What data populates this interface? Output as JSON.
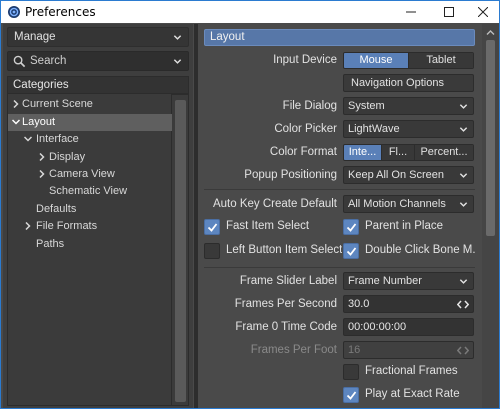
{
  "window": {
    "title": "Preferences"
  },
  "sidebar": {
    "manage_label": "Manage",
    "search_placeholder": "Search",
    "categories_label": "Categories",
    "items": [
      {
        "label": "Current Scene",
        "expandable": true,
        "expanded": false,
        "level": 0
      },
      {
        "label": "Layout",
        "expandable": true,
        "expanded": true,
        "level": 0,
        "selected": true
      },
      {
        "label": "Interface",
        "expandable": true,
        "expanded": true,
        "level": 1
      },
      {
        "label": "Display",
        "expandable": true,
        "expanded": false,
        "level": 2
      },
      {
        "label": "Camera View",
        "expandable": true,
        "expanded": false,
        "level": 2
      },
      {
        "label": "Schematic View",
        "expandable": false,
        "level": 2
      },
      {
        "label": "Defaults",
        "expandable": false,
        "level": 1
      },
      {
        "label": "File Formats",
        "expandable": true,
        "expanded": false,
        "level": 0
      },
      {
        "label": "Paths",
        "expandable": false,
        "level": 0
      }
    ]
  },
  "main": {
    "section_title": "Layout",
    "input_device": {
      "label": "Input Device",
      "options": [
        "Mouse",
        "Tablet"
      ],
      "selected": "Mouse"
    },
    "navigation_options_label": "Navigation Options",
    "file_dialog": {
      "label": "File Dialog",
      "value": "System"
    },
    "color_picker": {
      "label": "Color Picker",
      "value": "LightWave"
    },
    "color_format": {
      "label": "Color Format",
      "options": [
        "Inte...",
        "Fl...",
        "Percent..."
      ],
      "selected": "Inte..."
    },
    "popup_positioning": {
      "label": "Popup Positioning",
      "value": "Keep All On Screen"
    },
    "auto_key_create_default": {
      "label": "Auto Key Create Default",
      "value": "All Motion Channels"
    },
    "checkboxes": {
      "fast_item_select": {
        "label": "Fast Item Select",
        "checked": true
      },
      "parent_in_place": {
        "label": "Parent in Place",
        "checked": true
      },
      "left_button_item_select": {
        "label": "Left Button Item Select",
        "checked": false
      },
      "double_click_bone_mode": {
        "label": "Double Click Bone M...",
        "checked": true
      }
    },
    "frame_slider_label": {
      "label": "Frame Slider Label",
      "value": "Frame Number"
    },
    "frames_per_second": {
      "label": "Frames Per Second",
      "value": "30.0"
    },
    "frame_0_time_code": {
      "label": "Frame 0 Time Code",
      "value": "00:00:00:00"
    },
    "frames_per_foot": {
      "label": "Frames Per Foot",
      "value": "16"
    },
    "fractional_frames": {
      "label": "Fractional Frames",
      "checked": false
    },
    "play_at_exact_rate": {
      "label": "Play at Exact Rate",
      "checked": true
    }
  },
  "colors": {
    "accent": "#5777a8",
    "checkbox_checked": "#5d86c0",
    "window_border": "#2b7bd0"
  }
}
